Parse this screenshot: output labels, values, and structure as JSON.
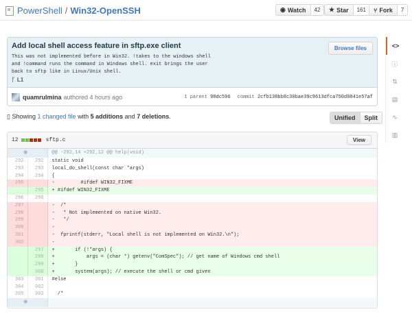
{
  "repo": {
    "owner": "PowerShell",
    "separator": "/",
    "name": "Win32-OpenSSH"
  },
  "social": {
    "watch_label": "Watch",
    "watch_count": "42",
    "star_label": "Star",
    "star_count": "161",
    "fork_label": "Fork",
    "fork_count": "7"
  },
  "sidebar_icons": [
    "code-icon",
    "issues-icon",
    "pull-requests-icon",
    "wiki-icon",
    "pulse-icon",
    "graphs-icon"
  ],
  "commit": {
    "title": "Add local shell access feature in sftp.exe client",
    "description": "This was not implemented before in Win32. !takes to the windows shell\nand !command runs the command in Windows shell. exit brings the user\nback to sftp like in Linux/Unix shell.",
    "browse_label": "Browse files",
    "branch": "L1",
    "author": "quamrulmina",
    "authored": "authored 4 hours ago",
    "parent_label": "1 parent",
    "parent_sha": "98dc596",
    "commit_label": "commit",
    "commit_sha": "2cfb138bb8c30bae39c9613dfca750d9841e57af"
  },
  "toc": {
    "showing": "Showing",
    "changed": "1 changed file",
    "with": "with",
    "additions": "5 additions",
    "and": "and",
    "deletions": "7 deletions",
    "end": "."
  },
  "view_switch": {
    "unified": "Unified",
    "split": "Split"
  },
  "file": {
    "stat_count": "12",
    "name": "sftp.c",
    "view_label": "View",
    "hunk": "@@ -292,14 +292,12 @@ help(void)",
    "expand_icon": "expand-icon",
    "lines": [
      {
        "type": "ctx",
        "old": "292",
        "new": "292",
        "text": "static void"
      },
      {
        "type": "ctx",
        "old": "293",
        "new": "293",
        "text": "local_do_shell(const char *args)"
      },
      {
        "type": "ctx",
        "old": "294",
        "new": "294",
        "text": "{"
      },
      {
        "type": "del",
        "old": "295",
        "new": "",
        "text": "-         #ifdef WIN32_FIXME"
      },
      {
        "type": "add",
        "old": "",
        "new": "295",
        "text": "+ #ifdef WIN32_FIXME"
      },
      {
        "type": "ctx",
        "old": "296",
        "new": "296",
        "text": ""
      },
      {
        "type": "del",
        "old": "297",
        "new": "",
        "text": "-  /*"
      },
      {
        "type": "del",
        "old": "298",
        "new": "",
        "text": "-   * Not implemented on native Win32."
      },
      {
        "type": "del",
        "old": "299",
        "new": "",
        "text": "-   */"
      },
      {
        "type": "del",
        "old": "300",
        "new": "",
        "text": "-"
      },
      {
        "type": "del",
        "old": "301",
        "new": "",
        "text": "-  fprintf(stderr, \"Local shell is not implemented on Win32.\\n\");"
      },
      {
        "type": "del",
        "old": "302",
        "new": "",
        "text": "-"
      },
      {
        "type": "add",
        "old": "",
        "new": "297",
        "text": "+       if (!*args) {"
      },
      {
        "type": "add",
        "old": "",
        "new": "298",
        "text": "+           args = (char *) getenv(\"ComSpec\"); // get name of Windows cmd shell"
      },
      {
        "type": "add",
        "old": "",
        "new": "299",
        "text": "+       }"
      },
      {
        "type": "add",
        "old": "",
        "new": "300",
        "text": "+       system(args); // execute the shell or cmd given"
      },
      {
        "type": "ctx",
        "old": "303",
        "new": "301",
        "text": "#else"
      },
      {
        "type": "ctx",
        "old": "304",
        "new": "302",
        "text": ""
      },
      {
        "type": "ctx",
        "old": "305",
        "new": "303",
        "text": "  /*"
      }
    ]
  },
  "colors": {
    "link": "#4078c0",
    "add_bg": "#eaffea",
    "del_bg": "#ffecec",
    "commit_bg": "#e6f1f6"
  }
}
